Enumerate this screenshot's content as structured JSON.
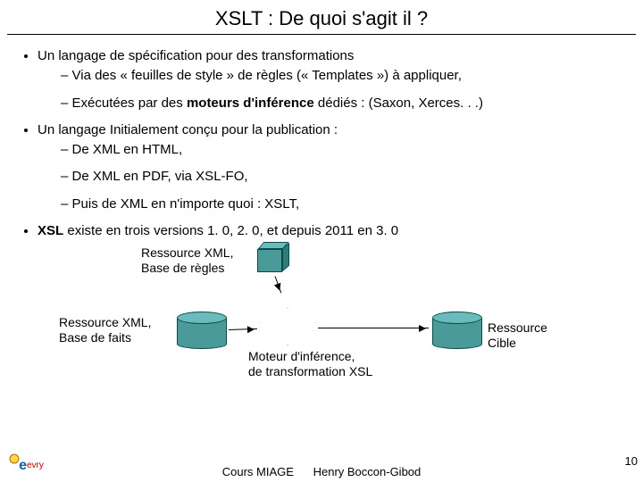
{
  "title": "XSLT : De quoi s'agit il ?",
  "bullets": {
    "b1": "Un langage de spécification pour des transformations",
    "b1_1": "Via des « feuilles de style » de règles (« Templates »)  à appliquer,",
    "b1_2_pre": "Exécutées par des ",
    "b1_2_bold": "moteurs d'inférence",
    "b1_2_post": " dédiés : (Saxon, Xerces. . .)",
    "b2": "Un langage Initialement conçu pour la publication :",
    "b2_1": "De XML en HTML,",
    "b2_2": "De XML en PDF, via XSL-FO,",
    "b2_3": "Puis de XML en n'importe quoi : XSLT,",
    "b3_pre": "XSL",
    "b3_post": " existe en trois  versions  1. 0,  2. 0,  et depuis 2011  en 3. 0"
  },
  "diagram": {
    "rules": "Ressource XML,\nBase de règles",
    "facts": "Ressource XML,\nBase de faits",
    "engine": "Moteur d'inférence,\nde transformation XSL",
    "target": "Ressource Cible"
  },
  "footer": {
    "course": "Cours MIAGE",
    "author": "Henry Boccon-Gibod"
  },
  "page": "10",
  "logo_text": "evry"
}
